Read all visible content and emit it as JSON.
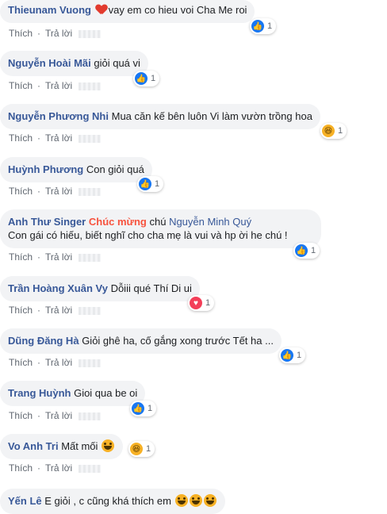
{
  "actions": {
    "like": "Thích",
    "reply": "Trả lời"
  },
  "colors": {
    "author": "#385898",
    "bubble": "#f2f3f5",
    "like": "#1877f2",
    "love": "#f33e58"
  },
  "comments": [
    {
      "author": "Thieunam Vuong",
      "text": "vay em co hieu voi Cha Me roi",
      "has_heart_emoji": true,
      "reaction": "like",
      "count": "1"
    },
    {
      "author": "Nguyễn Hoài Mãi",
      "text": "giỏi quá vi",
      "reaction": "like",
      "count": "1"
    },
    {
      "author": "Nguyễn Phương Nhi",
      "text": "Mua căn kế bên luôn Vi làm vườn trồng hoa",
      "reaction": "haha",
      "count": "1"
    },
    {
      "author": "Huỳnh Phương",
      "text": "Con giỏi quá",
      "reaction": "like",
      "count": "1"
    },
    {
      "author": "Anh Thư Singer",
      "sticker_text": "Chúc mừng",
      "text_before_mention": "chú",
      "mention": "Nguyễn Minh Quý",
      "text_line2": "Con gái có hiếu, biết nghĩ cho cha mẹ là vui và hp ời he chú !",
      "reaction": "like",
      "count": "1"
    },
    {
      "author": "Trần Hoàng Xuân Vy",
      "text": "Dỗiii qué Thí Di ui",
      "reaction": "love",
      "count": "1"
    },
    {
      "author": "Dũng Đăng Hà",
      "text": "Giỏi ghê ha, cố gắng xong trước Tết ha ...",
      "reaction": "like",
      "count": "1"
    },
    {
      "author": "Trang Huỳnh",
      "text": "Gioi qua be oi",
      "reaction": "like",
      "count": "1"
    },
    {
      "author": "Vo Anh Tri",
      "text": "Mất mối",
      "reaction": "haha",
      "count": "1"
    },
    {
      "author": "Yến Lê",
      "text": "E giỏi , c cũng khá thích em"
    }
  ]
}
